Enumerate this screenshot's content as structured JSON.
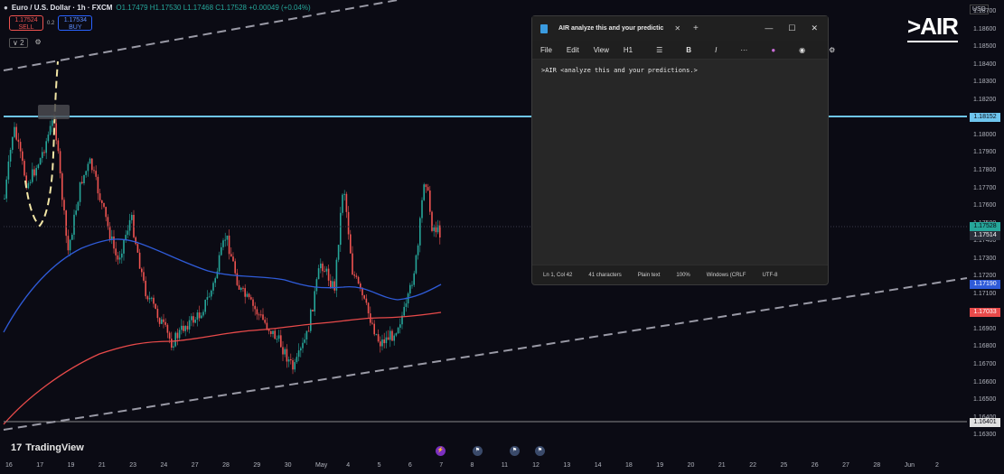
{
  "header": {
    "symbol": "Euro / U.S. Dollar · 1h · FXCM",
    "ohlc": "O1.17479 H1.17530 L1.17468 C1.17528 +0.00049 (+0.04%)"
  },
  "trade": {
    "sell_price": "1.17524",
    "sell_label": "SELL",
    "spread": "0.2",
    "buy_price": "1.17534",
    "buy_label": "BUY",
    "indicator_count": "2"
  },
  "brand": {
    "logo": ">AIR",
    "footer": "TradingView",
    "currency": "USD"
  },
  "notepad": {
    "title": "AIR analyze this and your predictic",
    "menu": [
      "File",
      "Edit",
      "View"
    ],
    "heading": "H1",
    "content": ">AIR <analyze this and your predictions.>",
    "status": {
      "position": "Ln 1, Col 42",
      "chars": "41 characters",
      "format": "Plain text",
      "zoom": "100%",
      "eol": "Windows (CRLF",
      "encoding": "UTF-8"
    }
  },
  "price_axis": [
    "1.18700",
    "1.18600",
    "1.18500",
    "1.18400",
    "1.18300",
    "1.18200",
    "1.18100",
    "1.18000",
    "1.17900",
    "1.17800",
    "1.17700",
    "1.17600",
    "1.17500",
    "1.17400",
    "1.17300",
    "1.17200",
    "1.17100",
    "1.17000",
    "1.16900",
    "1.16800",
    "1.16700",
    "1.16600",
    "1.16500",
    "1.16400",
    "1.16300"
  ],
  "price_tags": {
    "resistance": "1.18152",
    "current": "1.17528",
    "ask": "1.17514",
    "ma_blue": "1.17190",
    "ma_red": "1.17033",
    "support": "1.16401"
  },
  "time_axis": [
    "16",
    "17",
    "19",
    "21",
    "23",
    "24",
    "27",
    "28",
    "29",
    "30",
    "May",
    "4",
    "5",
    "6",
    "7",
    "8",
    "11",
    "12",
    "13",
    "14",
    "18",
    "19",
    "20",
    "21",
    "22",
    "25",
    "26",
    "27",
    "28",
    "Jun",
    "2"
  ],
  "colors": {
    "background": "#0b0b14",
    "up": "#26a69a",
    "down": "#ef5350",
    "ma_fast": "#2f5bd8",
    "ma_slow": "#e84a4a",
    "resistance": "#6ec5ee",
    "trendline": "#9a9aa6"
  }
}
